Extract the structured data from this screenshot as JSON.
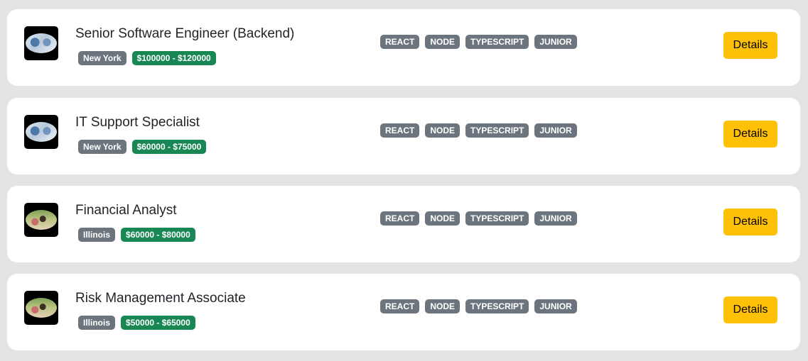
{
  "jobs": [
    {
      "image": "office-team-photo",
      "title": "Senior Software Engineer (Backend)",
      "location": "New York",
      "salary": "$100000 - $120000",
      "tags": [
        "REACT",
        "NODE",
        "TYPESCRIPT",
        "JUNIOR"
      ],
      "details_label": "Details"
    },
    {
      "image": "office-team-photo",
      "title": "IT Support Specialist",
      "location": "New York",
      "salary": "$60000 - $75000",
      "tags": [
        "REACT",
        "NODE",
        "TYPESCRIPT",
        "JUNIOR"
      ],
      "details_label": "Details"
    },
    {
      "image": "outdoor-people-photo",
      "title": "Financial Analyst",
      "location": "Illinois",
      "salary": "$60000 - $80000",
      "tags": [
        "REACT",
        "NODE",
        "TYPESCRIPT",
        "JUNIOR"
      ],
      "details_label": "Details"
    },
    {
      "image": "outdoor-people-photo",
      "title": "Risk Management Associate",
      "location": "Illinois",
      "salary": "$50000 - $65000",
      "tags": [
        "REACT",
        "NODE",
        "TYPESCRIPT",
        "JUNIOR"
      ],
      "details_label": "Details"
    }
  ],
  "colors": {
    "page_background": "#e4e4e4",
    "card_background": "#ffffff",
    "location_badge": "#6c757d",
    "salary_badge": "#198754",
    "tag_badge": "#6c757d",
    "details_button": "#ffc107"
  }
}
